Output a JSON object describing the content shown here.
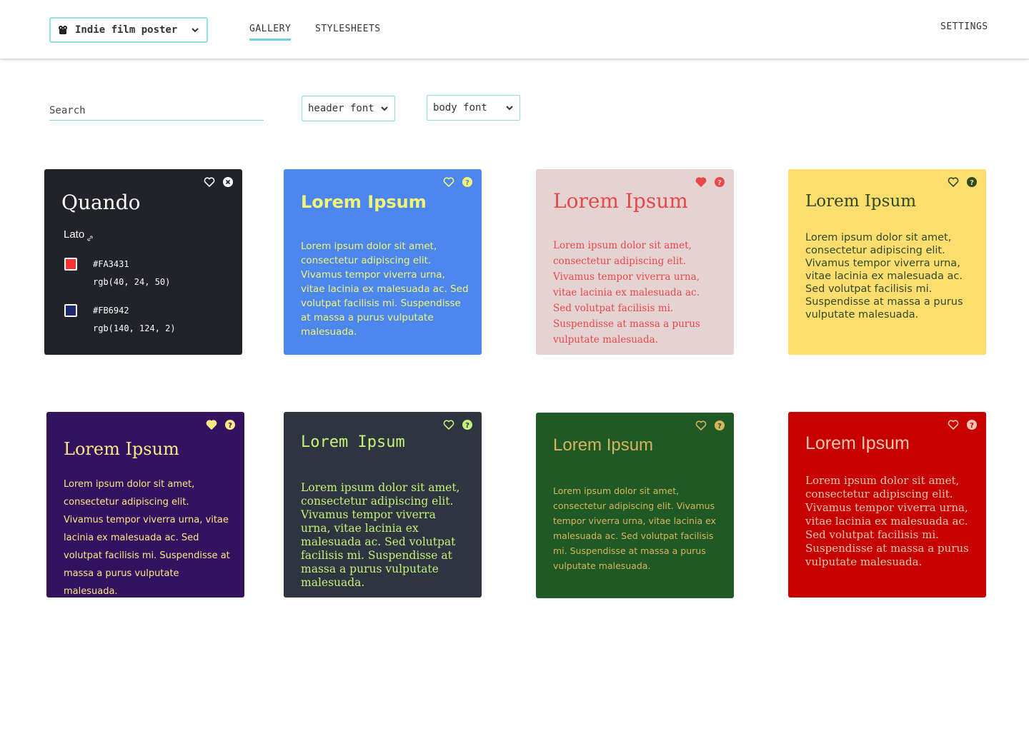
{
  "header": {
    "project": "Indie film poster",
    "tabs": [
      {
        "label": "GALLERY",
        "active": true
      },
      {
        "label": "STYLESHEETS",
        "active": false
      }
    ],
    "settings": "SETTINGS"
  },
  "filters": {
    "search_placeholder": "Search",
    "header_font": "header font",
    "body_font": "body font"
  },
  "detail_card": {
    "header_font": "Quando",
    "body_font": "Lato",
    "colors": [
      {
        "hex": "#FA3431",
        "rgb": "rgb(40, 24, 50)",
        "swatch": "#FA3431"
      },
      {
        "hex": "#FB6942",
        "rgb": "rgb(140, 124, 2)",
        "swatch": "#1d2a6e"
      }
    ],
    "bg": "#22222a"
  },
  "cards": [
    {
      "title": "Lorem Ipsum",
      "body": "Lorem ipsum dolor sit amet, consectetur adipiscing elit. Vivamus tempor viverra urna, vitae lacinia ex malesuada ac. Sed volutpat facilisis mi. Suspendisse at massa a purus vulputate malesuada.",
      "bg": "#4c87f0",
      "fg": "#f2f574",
      "favorited": false
    },
    {
      "title": "Lorem Ipsum",
      "body": "Lorem ipsum dolor sit amet, consectetur adipiscing elit. Vivamus tempor viverra urna, vitae lacinia ex malesuada ac. Sed volutpat facilisis mi. Suspendisse at massa a purus vulputate malesuada.",
      "bg": "#e5d3d4",
      "fg": "#e84848",
      "favorited": true
    },
    {
      "title": "Lorem Ipsum",
      "body": "Lorem ipsum dolor sit amet, consectetur adipiscing elit. Vivamus tempor viverra urna, vitae lacinia ex malesuada ac. Sed volutpat facilisis mi. Suspendisse at massa a purus vulputate malesuada.",
      "bg": "#fddd6e",
      "fg": "#2f4a23",
      "favorited": false
    },
    {
      "title": "Lorem Ipsum",
      "body": "Lorem ipsum dolor sit amet, consectetur adipiscing elit. Vivamus tempor viverra urna, vitae lacinia ex malesuada ac. Sed volutpat facilisis mi. Suspendisse at massa a purus vulputate malesuada.",
      "bg": "#331260",
      "fg": "#fbe883",
      "favorited": true
    },
    {
      "title": "Lorem Ipsum",
      "body": "Lorem ipsum dolor sit amet, consectetur adipiscing elit. Vivamus tempor viverra urna, vitae lacinia ex malesuada ac. Sed volutpat facilisis mi. Suspendisse at massa a purus vulputate malesuada.",
      "bg": "#2e3440",
      "fg": "#c5f07a",
      "favorited": false
    },
    {
      "title": "Lorem Ipsum",
      "body": "Lorem ipsum dolor sit amet, consectetur adipiscing elit. Vivamus tempor viverra urna, vitae lacinia ex malesuada ac. Sed volutpat facilisis mi. Suspendisse at massa a purus vulputate malesuada.",
      "bg": "#1f5a26",
      "fg": "#d8b35c",
      "favorited": false
    },
    {
      "title": "Lorem Ipsum",
      "body": "Lorem ipsum dolor sit amet, consectetur adipiscing elit. Vivamus tempor viverra urna, vitae lacinia ex malesuada ac. Sed volutpat facilisis mi. Suspendisse at massa a purus vulputate malesuada.",
      "bg": "#c70000",
      "fg": "#f6c6b3",
      "favorited": false
    }
  ],
  "icons": {
    "project": "film-reel-icon",
    "dropdown": "chevron-down-icon",
    "favorite": "heart-icon",
    "help": "question-icon",
    "close": "close-icon",
    "link": "link-icon"
  }
}
